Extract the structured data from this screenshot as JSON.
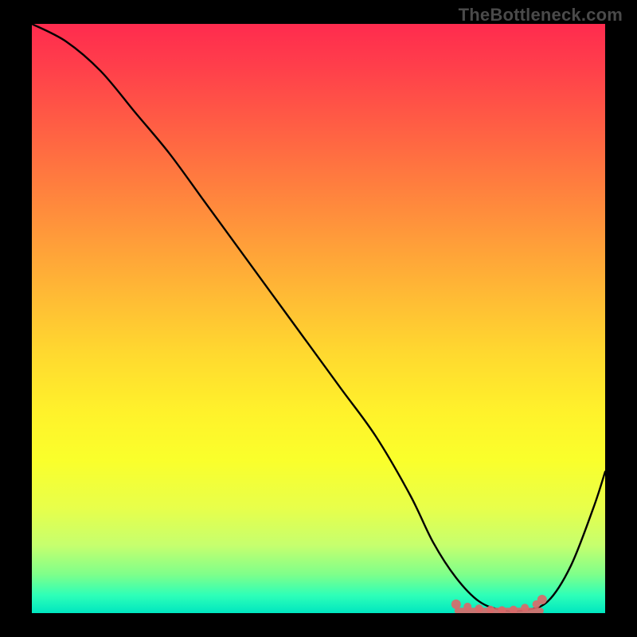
{
  "watermark": "TheBottleneck.com",
  "colors": {
    "background": "#000000",
    "gradient_top": "#ff2b4e",
    "gradient_bottom": "#00e6c0",
    "curve": "#000000",
    "marker": "#d86a6a"
  },
  "chart_data": {
    "type": "line",
    "title": "",
    "xlabel": "",
    "ylabel": "",
    "xlim": [
      0,
      100
    ],
    "ylim": [
      0,
      100
    ],
    "grid": false,
    "series": [
      {
        "name": "curve",
        "x": [
          0,
          6,
          12,
          18,
          24,
          30,
          36,
          42,
          48,
          54,
          60,
          66,
          70,
          74,
          78,
          82,
          86,
          90,
          94,
          98,
          100
        ],
        "values": [
          100,
          97,
          92,
          85,
          78,
          70,
          62,
          54,
          46,
          38,
          30,
          20,
          12,
          6,
          2,
          0.5,
          0.5,
          2,
          8,
          18,
          24
        ]
      }
    ],
    "markers": {
      "name": "flat-region",
      "x": [
        74,
        76,
        78,
        80,
        82,
        84,
        86,
        88,
        89
      ],
      "values": [
        1.5,
        1.1,
        0.8,
        0.6,
        0.5,
        0.6,
        0.9,
        1.5,
        2.3
      ]
    }
  }
}
